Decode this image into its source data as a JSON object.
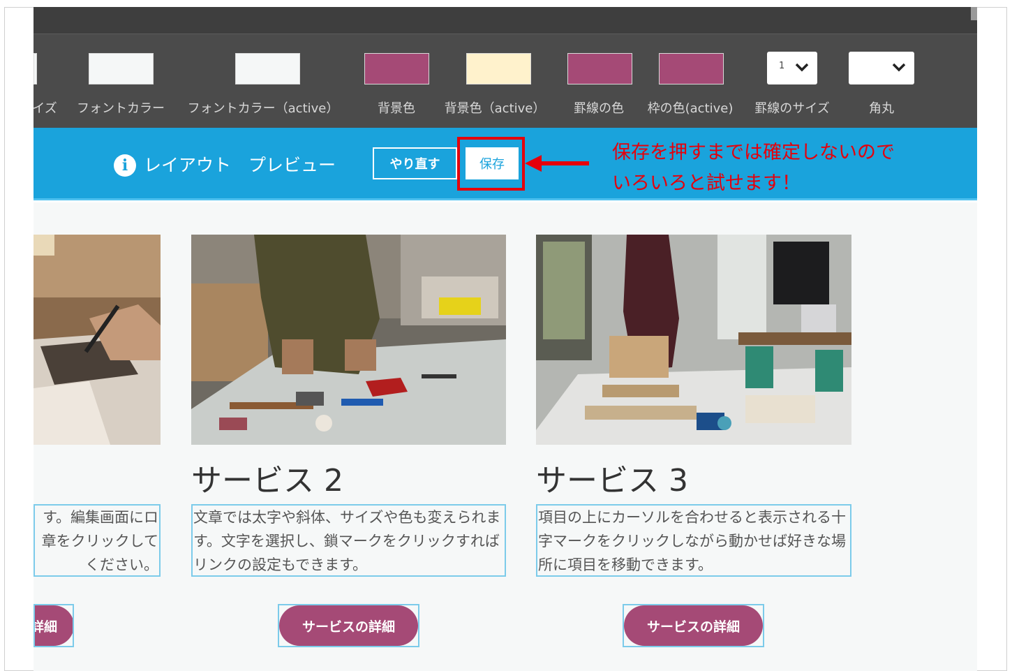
{
  "toolbar": {
    "items": [
      {
        "label": "イズ",
        "kind": "swatch",
        "color": "#f5f7f7"
      },
      {
        "label": "フォントカラー",
        "kind": "swatch",
        "color": "#f5f7f7"
      },
      {
        "label": "フォントカラー（active）",
        "kind": "swatch",
        "color": "#f5f7f7"
      },
      {
        "label": "背景色",
        "kind": "swatch",
        "color": "#a54a76"
      },
      {
        "label": "背景色（active）",
        "kind": "swatch",
        "color": "#fff2cc"
      },
      {
        "label": "罫線の色",
        "kind": "swatch",
        "color": "#a54a76"
      },
      {
        "label": "枠の色(active)",
        "kind": "swatch",
        "color": "#a54a76"
      },
      {
        "label": "罫線のサイズ",
        "kind": "select",
        "value": "1"
      },
      {
        "label": "角丸",
        "kind": "select",
        "value": ""
      }
    ]
  },
  "preview_bar": {
    "title": "レイアウト　プレビュー",
    "redo_label": "やり直す",
    "save_label": "保存",
    "annotation_line1": "保存を押すまでは確定しないので",
    "annotation_line2": "いろいろと試せます！",
    "bar_color": "#1aa3dc",
    "highlight_color": "#e5000b"
  },
  "services": [
    {
      "title": "",
      "text_lines": [
        "す。編集画面にロ",
        "章をクリックして",
        "ください。"
      ],
      "button_label": "詳細"
    },
    {
      "title": "サービス 2",
      "text": "文章では太字や斜体、サイズや色も変えられます。文字を選択し、鎖マークをクリックすればリンクの設定もできます。",
      "button_label": "サービスの詳細"
    },
    {
      "title": "サービス 3",
      "text": "項目の上にカーソルを合わせると表示される十字マークをクリックしながら動かせば好きな場所に項目を移動できます。",
      "button_label": "サービスの詳細"
    }
  ],
  "accent_color": "#a54a76"
}
